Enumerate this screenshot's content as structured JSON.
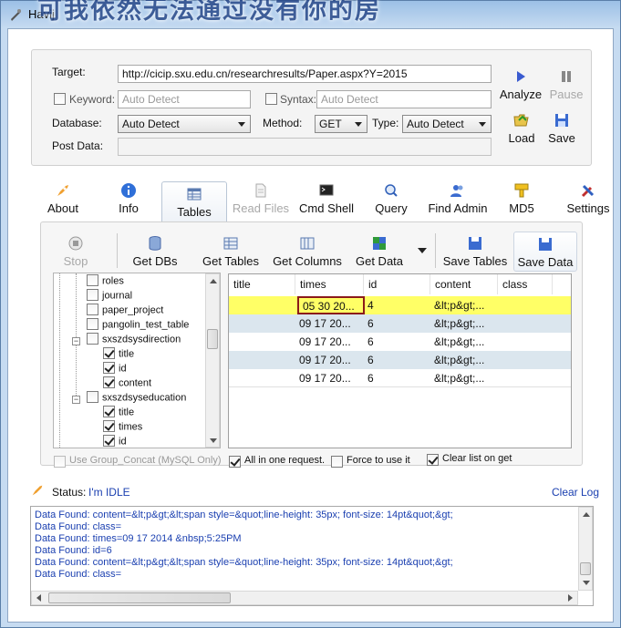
{
  "window": {
    "title": "Havij",
    "overlay_text": "可我依然无法通过没有你的房"
  },
  "target": {
    "label": "Target:",
    "value": "http://cicip.sxu.edu.cn/researchresults/Paper.aspx?Y=2015",
    "keyword_label": "Keyword:",
    "keyword_placeholder": "Auto Detect",
    "syntax_label": "Syntax:",
    "syntax_placeholder": "Auto Detect",
    "database_label": "Database:",
    "database_value": "Auto Detect",
    "method_label": "Method:",
    "method_value": "GET",
    "type_label": "Type:",
    "type_value": "Auto Detect",
    "postdata_label": "Post Data:"
  },
  "actions": {
    "analyze": "Analyze",
    "pause": "Pause",
    "load": "Load",
    "save": "Save"
  },
  "main_tabs": [
    {
      "label": "About",
      "icon": "rocket-icon"
    },
    {
      "label": "Info",
      "icon": "info-icon"
    },
    {
      "label": "Tables",
      "icon": "table-icon",
      "active": true
    },
    {
      "label": "Read Files",
      "icon": "file-icon",
      "disabled": true
    },
    {
      "label": "Cmd Shell",
      "icon": "terminal-icon"
    },
    {
      "label": "Query",
      "icon": "query-icon"
    },
    {
      "label": "Find Admin",
      "icon": "users-icon"
    },
    {
      "label": "MD5",
      "icon": "key-icon"
    },
    {
      "label": "Settings",
      "icon": "tools-icon"
    }
  ],
  "tables_toolbar": {
    "stop": "Stop",
    "get_dbs": "Get DBs",
    "get_tables": "Get Tables",
    "get_columns": "Get Columns",
    "get_data": "Get Data",
    "save_tables": "Save Tables",
    "save_data": "Save Data"
  },
  "tree": [
    {
      "label": "roles",
      "level": 2,
      "checked": false
    },
    {
      "label": "journal",
      "level": 2,
      "checked": false
    },
    {
      "label": "paper_project",
      "level": 2,
      "checked": false
    },
    {
      "label": "pangolin_test_table",
      "level": 2,
      "checked": false
    },
    {
      "label": "sxszdsysdirection",
      "level": 2,
      "checked": false,
      "expander": "−"
    },
    {
      "label": "title",
      "level": 3,
      "checked": true
    },
    {
      "label": "id",
      "level": 3,
      "checked": true
    },
    {
      "label": "content",
      "level": 3,
      "checked": true
    },
    {
      "label": "sxszdsyseducation",
      "level": 2,
      "checked": false,
      "expander": "−"
    },
    {
      "label": "title",
      "level": 3,
      "checked": true
    },
    {
      "label": "times",
      "level": 3,
      "checked": true
    },
    {
      "label": "id",
      "level": 3,
      "checked": true
    }
  ],
  "grid": {
    "headers": [
      "title",
      "times",
      "id",
      "content",
      "class"
    ],
    "rows": [
      {
        "title": "",
        "times": "05 30 20...",
        "id": "4",
        "content": "&lt;p&gt;...",
        "class": "",
        "selected": true
      },
      {
        "title": "",
        "times": "09 17 20...",
        "id": "6",
        "content": "&lt;p&gt;...",
        "class": ""
      },
      {
        "title": "",
        "times": "09 17 20...",
        "id": "6",
        "content": "&lt;p&gt;...",
        "class": ""
      },
      {
        "title": "",
        "times": "09 17 20...",
        "id": "6",
        "content": "&lt;p&gt;...",
        "class": ""
      },
      {
        "title": "",
        "times": "09 17 20...",
        "id": "6",
        "content": "&lt;p&gt;...",
        "class": ""
      }
    ]
  },
  "options": {
    "group_concat": "Use Group_Concat (MySQL Only)",
    "all_in_one": "All in one request.",
    "force": "Force to use it",
    "clear_list": "Clear list on get"
  },
  "status": {
    "label": "Status:",
    "value": "I'm IDLE",
    "clear_log": "Clear Log"
  },
  "log": [
    "Data Found: content=&lt;p&gt;&lt;span style=&quot;line-height: 35px; font-size: 14pt&quot;&gt;",
    "Data Found: class=",
    "Data Found: times=09 17 2014 &nbsp;5:25PM",
    "Data Found: id=6",
    "Data Found: content=&lt;p&gt;&lt;span style=&quot;line-height: 35px; font-size: 14pt&quot;&gt;",
    "Data Found: class="
  ],
  "colors": {
    "accent": "#1a3fb0",
    "selected_row": "#ffff66",
    "alt_row": "#dbe6ee"
  }
}
